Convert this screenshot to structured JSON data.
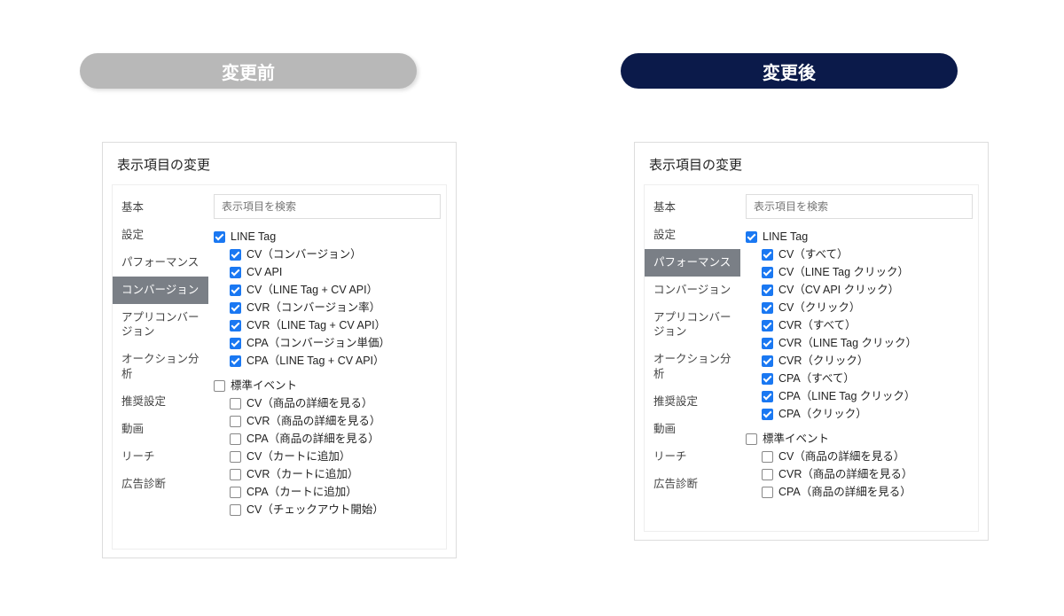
{
  "headers": {
    "before": "変更前",
    "after": "変更後"
  },
  "panel_title": "表示項目の変更",
  "search_placeholder": "表示項目を検索",
  "sidebar": {
    "items": [
      {
        "label": "基本"
      },
      {
        "label": "設定"
      },
      {
        "label": "パフォーマンス"
      },
      {
        "label": "コンバージョン"
      },
      {
        "label": "アプリコンバージョン"
      },
      {
        "label": "オークション分析"
      },
      {
        "label": "推奨設定"
      },
      {
        "label": "動画"
      },
      {
        "label": "リーチ"
      },
      {
        "label": "広告診断"
      }
    ],
    "active_before": 3,
    "active_after": 2
  },
  "before": {
    "groups": [
      {
        "label": "LINE Tag",
        "checked": true,
        "children": [
          {
            "label": "CV（コンバージョン）",
            "checked": true
          },
          {
            "label": "CV API",
            "checked": true
          },
          {
            "label": "CV（LINE Tag + CV API）",
            "checked": true
          },
          {
            "label": "CVR（コンバージョン率）",
            "checked": true
          },
          {
            "label": "CVR（LINE Tag + CV API）",
            "checked": true
          },
          {
            "label": "CPA（コンバージョン単価）",
            "checked": true
          },
          {
            "label": "CPA（LINE Tag + CV API）",
            "checked": true
          }
        ]
      },
      {
        "label": "標準イベント",
        "checked": false,
        "children": [
          {
            "label": "CV（商品の詳細を見る）",
            "checked": false
          },
          {
            "label": "CVR（商品の詳細を見る）",
            "checked": false
          },
          {
            "label": "CPA（商品の詳細を見る）",
            "checked": false
          },
          {
            "label": "CV（カートに追加）",
            "checked": false
          },
          {
            "label": "CVR（カートに追加）",
            "checked": false
          },
          {
            "label": "CPA（カートに追加）",
            "checked": false
          },
          {
            "label": "CV（チェックアウト開始）",
            "checked": false
          }
        ]
      }
    ]
  },
  "after": {
    "groups": [
      {
        "label": "LINE Tag",
        "checked": true,
        "children": [
          {
            "label": "CV（すべて）",
            "checked": true
          },
          {
            "label": "CV（LINE Tag クリック）",
            "checked": true
          },
          {
            "label": "CV（CV API クリック）",
            "checked": true
          },
          {
            "label": "CV（クリック）",
            "checked": true
          },
          {
            "label": "CVR（すべて）",
            "checked": true
          },
          {
            "label": "CVR（LINE Tag クリック）",
            "checked": true
          },
          {
            "label": "CVR（クリック）",
            "checked": true
          },
          {
            "label": "CPA（すべて）",
            "checked": true
          },
          {
            "label": "CPA（LINE Tag クリック）",
            "checked": true
          },
          {
            "label": "CPA（クリック）",
            "checked": true
          }
        ]
      },
      {
        "label": "標準イベント",
        "checked": false,
        "children": [
          {
            "label": "CV（商品の詳細を見る）",
            "checked": false
          },
          {
            "label": "CVR（商品の詳細を見る）",
            "checked": false
          },
          {
            "label": "CPA（商品の詳細を見る）",
            "checked": false
          }
        ]
      }
    ]
  }
}
